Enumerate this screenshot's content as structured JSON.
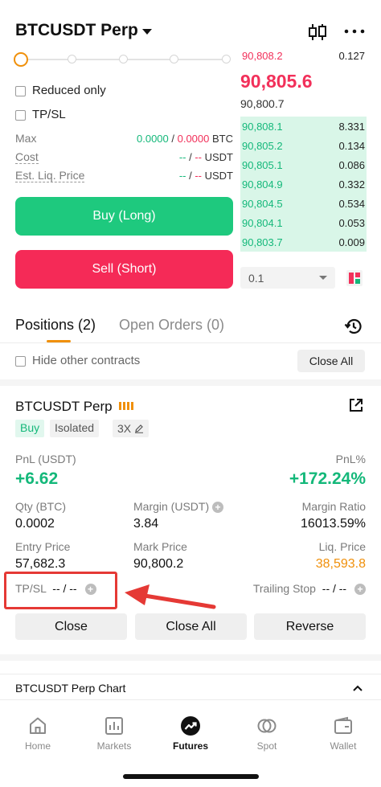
{
  "header": {
    "title": "BTCUSDT Perp",
    "icons": [
      "chevron-down-icon",
      "candlestick-chart-icon",
      "more-icon"
    ]
  },
  "order_form": {
    "leverage_slider_position": 0,
    "reduced_only_label": "Reduced only",
    "tpsl_label": "TP/SL",
    "max_label": "Max",
    "max_buy": "0.0000",
    "max_sep": " / ",
    "max_sell": "0.0000",
    "max_unit": " BTC",
    "cost_label": "Cost",
    "cost_buy": "--",
    "cost_sep": " / ",
    "cost_sell": "--",
    "cost_unit": " USDT",
    "liq_label": "Est. Liq. Price",
    "liq_buy": "--",
    "liq_sep": " / ",
    "liq_sell": "--",
    "liq_unit": " USDT",
    "buy_label": "Buy (Long)",
    "sell_label": "Sell (Short)"
  },
  "orderbook": {
    "asks": [
      {
        "price": "90,808.2",
        "qty": "0.127"
      }
    ],
    "last_price": "90,805.6",
    "mark_price": "90,800.7",
    "bids": [
      {
        "price": "90,808.1",
        "qty": "8.331"
      },
      {
        "price": "90,805.2",
        "qty": "0.134"
      },
      {
        "price": "90,805.1",
        "qty": "0.086"
      },
      {
        "price": "90,804.9",
        "qty": "0.332"
      },
      {
        "price": "90,804.5",
        "qty": "0.534"
      },
      {
        "price": "90,804.1",
        "qty": "0.053"
      },
      {
        "price": "90,803.7",
        "qty": "0.009"
      }
    ],
    "precision": "0.1"
  },
  "tabs": {
    "positions": "Positions (2)",
    "open_orders": "Open Orders (0)"
  },
  "filters": {
    "hide_other_label": "Hide other contracts",
    "close_all_label": "Close All"
  },
  "position": {
    "symbol": "BTCUSDT Perp",
    "side_tag": "Buy",
    "margin_mode_tag": "Isolated",
    "leverage_tag": "3X",
    "pnl_label": "PnL (USDT)",
    "pnl_value": "+6.62",
    "pnl_pct_label": "PnL%",
    "pnl_pct_value": "+172.24%",
    "qty_label": "Qty (BTC)",
    "qty_value": "0.0002",
    "margin_label": "Margin (USDT)",
    "margin_value": "3.84",
    "margin_ratio_label": "Margin Ratio",
    "margin_ratio_value": "16013.59%",
    "entry_label": "Entry Price",
    "entry_value": "57,682.3",
    "mark_label": "Mark Price",
    "mark_value": "90,800.2",
    "liq_label": "Liq. Price",
    "liq_value": "38,593.8",
    "tpsl_label": "TP/SL",
    "tpsl_value": "-- / --",
    "trailing_label": "Trailing Stop",
    "trailing_value": "-- / --",
    "close_label": "Close",
    "close_all_label": "Close All",
    "reverse_label": "Reverse"
  },
  "chart_bar": {
    "label": "BTCUSDT Perp Chart"
  },
  "bottom_nav": [
    {
      "label": "Home",
      "icon": "home-icon",
      "active": false
    },
    {
      "label": "Markets",
      "icon": "markets-icon",
      "active": false
    },
    {
      "label": "Futures",
      "icon": "futures-icon",
      "active": true
    },
    {
      "label": "Spot",
      "icon": "spot-icon",
      "active": false
    },
    {
      "label": "Wallet",
      "icon": "wallet-icon",
      "active": false
    }
  ],
  "colors": {
    "buy": "#1ec97e",
    "sell": "#f52a57",
    "accent": "#f0900b",
    "annotation": "#e53935"
  }
}
